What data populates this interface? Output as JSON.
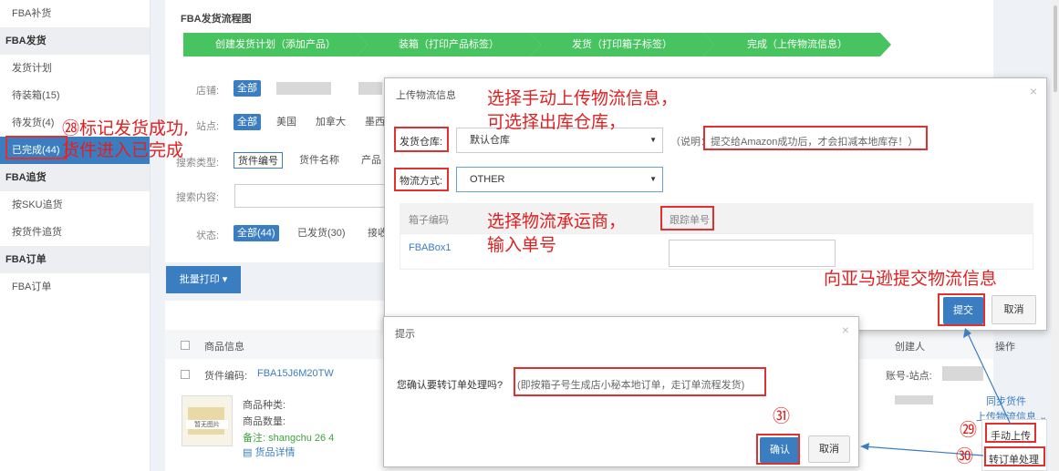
{
  "sidebar": {
    "items": [
      {
        "label": "FBA补货",
        "type": "item"
      },
      {
        "label": "FBA发货",
        "type": "head"
      },
      {
        "label": "发货计划",
        "type": "item"
      },
      {
        "label": "待装箱(15)",
        "type": "item"
      },
      {
        "label": "待发货(4)",
        "type": "item"
      },
      {
        "label": "已完成(44)",
        "type": "active"
      },
      {
        "label": "FBA追货",
        "type": "head"
      },
      {
        "label": "按SKU追货",
        "type": "item"
      },
      {
        "label": "按货件追货",
        "type": "item"
      },
      {
        "label": "FBA订单",
        "type": "head"
      },
      {
        "label": "FBA订单",
        "type": "item"
      }
    ]
  },
  "flow": {
    "title": "FBA发货流程图",
    "steps": [
      "创建发货计划（添加产品）",
      "装箱（打印产品标签）",
      "发货（打印箱子标签）",
      "完成（上传物流信息）"
    ]
  },
  "filters": {
    "store_label": "店铺:",
    "store_all": "全部",
    "site_label": "站点:",
    "site_all": "全部",
    "site_options": [
      "美国",
      "加拿大",
      "墨西"
    ],
    "search_type_label": "搜索类型:",
    "search_types": [
      "货件编号",
      "货件名称",
      "产品"
    ],
    "search_content_label": "搜索内容:",
    "status_label": "状态:",
    "status_all": "全部(44)",
    "status_shipped": "已发货(30)",
    "status_recv": "接收"
  },
  "batch_print": "批量打印",
  "table": {
    "header_product": "商品信息",
    "header_creator": "创建人",
    "header_action": "操作",
    "shipment_label": "货件编码:",
    "shipment_code": "FBA15J6M20TW",
    "account_label": "账号-站点:",
    "no_image": "暂无图片",
    "product_kind": "商品种类:",
    "product_qty": "商品数量:",
    "note": "备注: shangchu 26 4",
    "detail_link": "货品详情",
    "sync_link": "同步货件",
    "upload_link": "上传物流信息"
  },
  "dropdown": {
    "manual_upload": "手动上传",
    "convert_order": "转订单处理"
  },
  "upload_dialog": {
    "title": "上传物流信息",
    "warehouse_label": "发货仓库:",
    "warehouse_value": "默认仓库",
    "note": "（说明：提交给Amazon成功后，才会扣减本地库存！）",
    "carrier_label": "物流方式:",
    "carrier_value": "OTHER",
    "col_box": "箱子编码",
    "col_tracking": "跟踪单号",
    "box_code": "FBABox1",
    "submit": "提交",
    "cancel": "取消"
  },
  "confirm_dialog": {
    "title": "提示",
    "question": "您确认要转订单处理吗?",
    "hint": "(即按箱子号生成店小秘本地订单，走订单流程发货)",
    "confirm": "确认",
    "cancel": "取消"
  },
  "annotations": {
    "a28_line1": "㉘标记发货成功,",
    "a28_line2": "货件进入已完成",
    "manual_line1": "选择手动上传物流信息，",
    "manual_line2": "可选择出库仓库，",
    "carrier_line1": "选择物流承运商，",
    "carrier_line2": "输入单号",
    "submit_note": "向亚马逊提交物流信息",
    "n29": "㉙",
    "n30": "㉚",
    "n31": "㉛"
  },
  "colors": {
    "accent": "#3a7ec1",
    "flow_green": "#47c35f",
    "annotation_red": "#e02020"
  }
}
